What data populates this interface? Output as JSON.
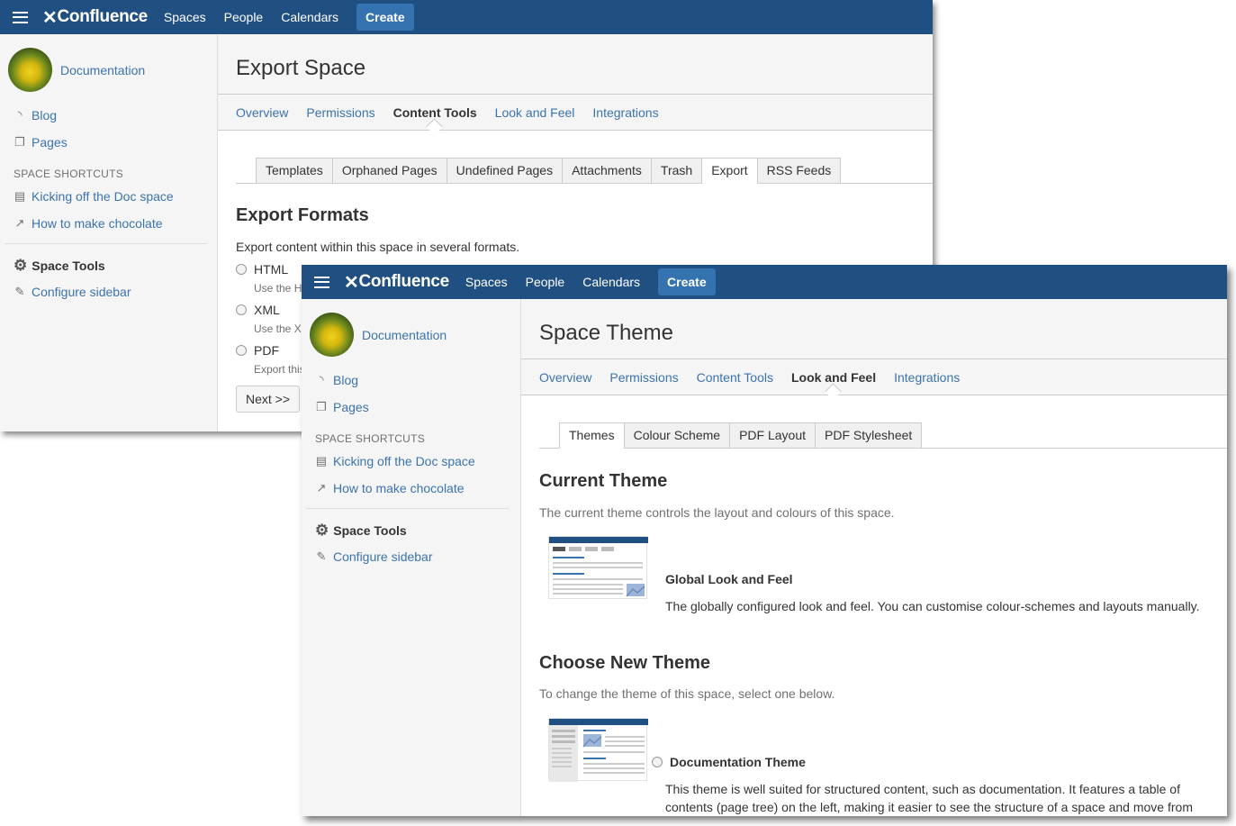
{
  "topbar": {
    "logo": "Confluence",
    "nav": [
      "Spaces",
      "People",
      "Calendars"
    ],
    "create": "Create"
  },
  "sidebar": {
    "space_name": "Documentation",
    "blog": "Blog",
    "pages": "Pages",
    "shortcuts_heading": "SPACE SHORTCUTS",
    "shortcuts": [
      "Kicking off the Doc space",
      "How to make chocolate"
    ],
    "space_tools": "Space Tools",
    "configure": "Configure sidebar"
  },
  "admin_tabs": [
    "Overview",
    "Permissions",
    "Content Tools",
    "Look and Feel",
    "Integrations"
  ],
  "export_window": {
    "title": "Export Space",
    "active_tab": "Content Tools",
    "subtabs": [
      "Templates",
      "Orphaned Pages",
      "Undefined Pages",
      "Attachments",
      "Trash",
      "Export",
      "RSS Feeds"
    ],
    "active_subtab": "Export",
    "section_title": "Export Formats",
    "description": "Export content within this space in several formats.",
    "formats": [
      {
        "label": "HTML",
        "desc": "Use the H"
      },
      {
        "label": "XML",
        "desc": "Use the X"
      },
      {
        "label": "PDF",
        "desc": "Export this"
      }
    ],
    "next_button": "Next >>"
  },
  "theme_window": {
    "title": "Space Theme",
    "active_tab": "Look and Feel",
    "subtabs": [
      "Themes",
      "Colour Scheme",
      "PDF Layout",
      "PDF Stylesheet"
    ],
    "active_subtab": "Themes",
    "current": {
      "heading": "Current Theme",
      "description": "The current theme controls the layout and colours of this space.",
      "theme_name": "Global Look and Feel",
      "theme_desc": "The globally configured look and feel. You can customise colour-schemes and layouts manually."
    },
    "choose": {
      "heading": "Choose New Theme",
      "description": "To change the theme of this space, select one below.",
      "theme_name": "Documentation Theme",
      "theme_desc": "This theme is well suited for structured content, such as documentation. It features a table of contents (page tree) on the left, making it easier to see the structure of a space and move from page to page. You can customise the left-hand panel, page header and page footer."
    }
  },
  "colors": {
    "topbar": "#205081",
    "create_button": "#3572b0",
    "link": "#3b73af"
  }
}
